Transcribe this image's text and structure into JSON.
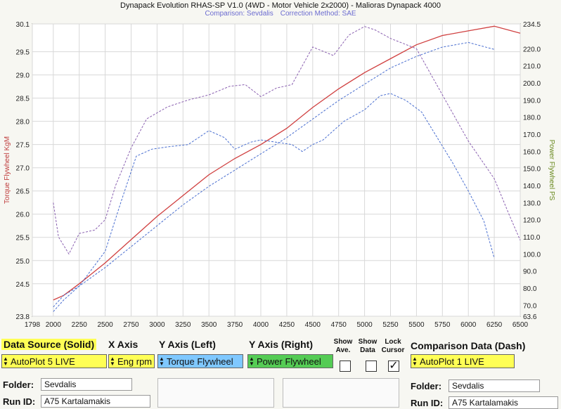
{
  "header": {
    "title": "Dynapack Evolution RHAS-SP V1.0  (4WD - Motor Vehicle 2x2000) - Malioras Dynapack 4000",
    "comparison_label": "Comparison: Sevdalis",
    "correction_label": "Correction Method: SAE"
  },
  "colors": {
    "torque_solid": "#d04040",
    "power_solid": "#e04050",
    "torque_dash": "#4a6fd0",
    "power_dash": "#8a60b0",
    "grid": "#d8d8d8",
    "yellow": "#ffff55",
    "blue": "#7fc8ff",
    "green": "#55cc55"
  },
  "chart_data": {
    "type": "line",
    "title": "",
    "xlabel": "",
    "ylabel": "Torque Flywheel KgM",
    "y2label": "Power Flywheel PS",
    "xlim": [
      1798,
      6500
    ],
    "ylim": [
      23.8,
      30.1
    ],
    "y2lim": [
      63.6,
      234.5
    ],
    "x_ticks": [
      1798,
      2000,
      2250,
      2500,
      2750,
      3000,
      3250,
      3500,
      3750,
      4000,
      4250,
      4500,
      4750,
      5000,
      5250,
      5500,
      5750,
      6000,
      6250,
      6500
    ],
    "y_ticks": [
      23.8,
      24.5,
      25.0,
      25.5,
      26.0,
      26.5,
      27.0,
      27.5,
      28.0,
      28.5,
      29.0,
      29.5,
      30.1
    ],
    "y2_ticks": [
      63.6,
      70.0,
      80.0,
      90.0,
      100.0,
      110.0,
      120.0,
      130.0,
      140.0,
      150.0,
      160.0,
      170.0,
      180.0,
      190.0,
      200.0,
      210.0,
      220.0,
      234.5
    ],
    "grid": true,
    "series": [
      {
        "axis": "left",
        "style": "solid",
        "color_key": "torque_solid",
        "x": [
          2000,
          2100,
          2250,
          2500,
          2750,
          3000,
          3250,
          3500,
          3750,
          4000,
          4250,
          4500,
          4750,
          5000,
          5250,
          5500,
          5750,
          6000,
          6250,
          6500
        ],
        "y": [
          24.15,
          24.25,
          24.5,
          24.95,
          25.45,
          25.95,
          26.4,
          26.85,
          27.2,
          27.5,
          27.85,
          28.3,
          28.7,
          29.05,
          29.35,
          29.65,
          29.85,
          29.95,
          30.05,
          29.9
        ]
      },
      {
        "axis": "left",
        "style": "dash",
        "color_key": "torque_dash",
        "x": [
          2000,
          2100,
          2250,
          2500,
          2750,
          3000,
          3250,
          3500,
          3750,
          4000,
          4250,
          4500,
          4750,
          5000,
          5250,
          5500,
          5750,
          6000,
          6250
        ],
        "y": [
          23.9,
          24.15,
          24.45,
          24.85,
          25.3,
          25.75,
          26.2,
          26.6,
          26.95,
          27.3,
          27.65,
          28.05,
          28.45,
          28.8,
          29.15,
          29.4,
          29.6,
          29.7,
          29.55
        ]
      },
      {
        "axis": "right",
        "style": "dash",
        "color_key": "power_dash",
        "x": [
          2000,
          2050,
          2150,
          2250,
          2400,
          2500,
          2600,
          2750,
          2900,
          3100,
          3300,
          3500,
          3700,
          3850,
          4000,
          4150,
          4300,
          4500,
          4700,
          4850,
          5000,
          5100,
          5250,
          5500,
          5750,
          6000,
          6250,
          6400,
          6500
        ],
        "y": [
          130,
          110,
          100,
          112,
          114,
          120,
          140,
          162,
          179,
          186,
          190,
          193,
          198,
          199,
          192,
          197,
          199,
          221,
          216,
          228,
          233,
          231,
          226,
          220,
          193,
          166,
          144,
          122,
          108
        ]
      },
      {
        "axis": "left",
        "style": "dash",
        "color_key": "torque_dash",
        "x": [
          2000,
          2100,
          2250,
          2500,
          2650,
          2800,
          2950,
          3100,
          3300,
          3500,
          3650,
          3750,
          3900,
          4000,
          4150,
          4300,
          4400,
          4500,
          4600,
          4700,
          4800,
          5000,
          5150,
          5250,
          5400,
          5550,
          5700,
          5850,
          6000,
          6150,
          6250
        ],
        "y": [
          24.0,
          24.25,
          24.45,
          25.2,
          26.25,
          27.25,
          27.4,
          27.45,
          27.5,
          27.8,
          27.65,
          27.4,
          27.55,
          27.6,
          27.55,
          27.5,
          27.35,
          27.5,
          27.6,
          27.8,
          28.0,
          28.25,
          28.55,
          28.6,
          28.45,
          28.2,
          27.65,
          27.1,
          26.5,
          25.85,
          25.05
        ]
      }
    ]
  },
  "controls": {
    "data_source_label": "Data Source (Solid)",
    "data_source_value": "AutoPlot 5 LIVE",
    "x_axis_label": "X Axis",
    "x_axis_value": "Eng rpm",
    "y_left_label": "Y Axis (Left)",
    "y_left_value": "Torque Flywheel",
    "y_right_label": "Y Axis (Right)",
    "y_right_value": "Power Flywheel",
    "show_ave_label_1": "Show",
    "show_ave_label_2": "Ave.",
    "show_data_label_1": "Show",
    "show_data_label_2": "Data",
    "lock_cursor_label_1": "Lock",
    "lock_cursor_label_2": "Cursor",
    "lock_cursor_mark": "✓",
    "comparison_label": "Comparison Data (Dash)",
    "comparison_value": "AutoPlot 1 LIVE",
    "folder_label": "Folder:",
    "folder_value": "Sevdalis",
    "run_id_label": "Run ID:",
    "run_id_value": "A75 Kartalamakis",
    "comp_folder_label": "Folder:",
    "comp_folder_value": "Sevdalis",
    "comp_run_id_label": "Run ID:",
    "comp_run_id_value": "A75 Kartalamakis"
  }
}
